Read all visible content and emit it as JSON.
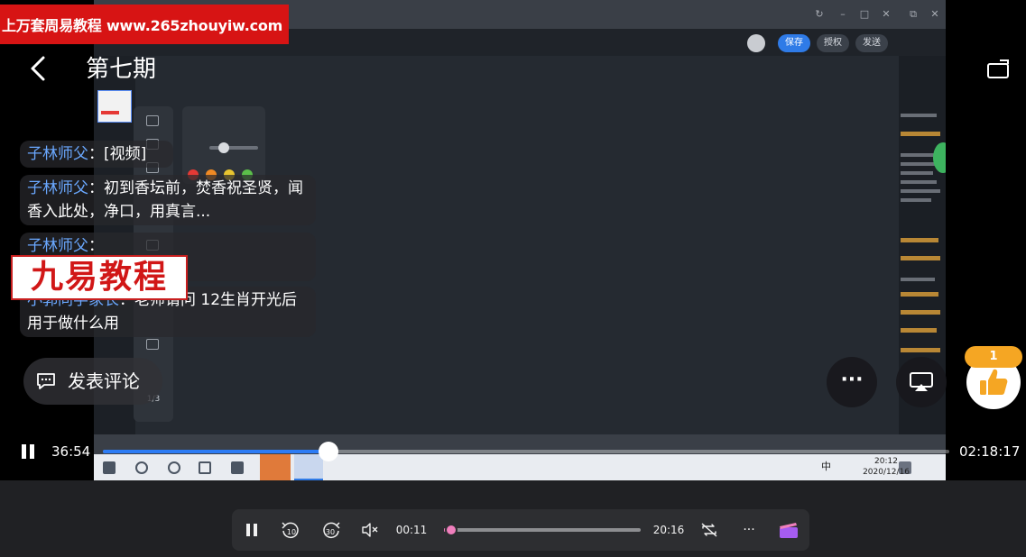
{
  "banner": {
    "text": "上万套周易教程 www.265zhouyiw.com"
  },
  "header": {
    "title": "第七期"
  },
  "comments": [
    {
      "author": "子林师父",
      "text": "[视频]"
    },
    {
      "author": "子林师父",
      "text": "初到香坛前，焚香祝圣贤，闻香入此处，净口，用真言..."
    },
    {
      "author": "子林师父",
      "text": ""
    },
    {
      "author": "小郭同学家长",
      "text": "老师请问 12生肖开光后用于做什么用"
    }
  ],
  "watermark": {
    "text": "九易教程"
  },
  "comment_button": {
    "label": "发表评论"
  },
  "like": {
    "count": "1"
  },
  "player": {
    "current": "36:54",
    "duration": "02:18:17",
    "progress": 0.267
  },
  "host_player": {
    "current": "00:11",
    "duration": "20:16",
    "progress": 0.009,
    "skip_back": "10",
    "skip_forward": "30"
  },
  "recording": {
    "taskbar_time": "20:12",
    "taskbar_date": "2020/12/16",
    "ime": "中",
    "buttons": [
      "保存",
      "授权",
      "发送"
    ],
    "page": "1/3"
  },
  "colors": {
    "banner": "#d71414",
    "comment_author": "#6aa8ff",
    "seek_fill": "#2d7cf5",
    "like_badge": "#f5a623",
    "host_seek_fill": "#e97bb6"
  }
}
